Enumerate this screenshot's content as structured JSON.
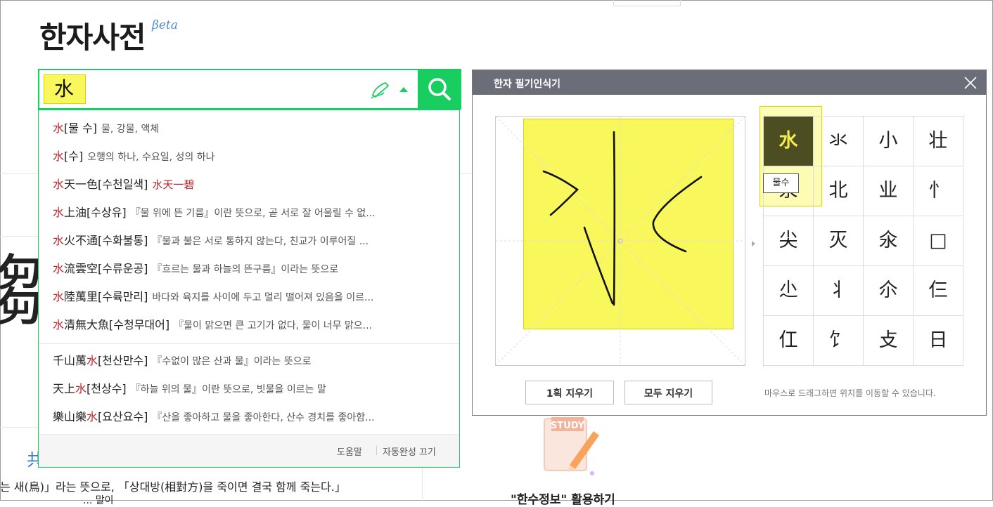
{
  "site": {
    "title": "한자사전",
    "beta": "βeta"
  },
  "search": {
    "value": "水"
  },
  "autocomplete": {
    "items": [
      {
        "pre": "",
        "hl": "水",
        "post": "",
        "reading": "[물 수]",
        "desc": "물, 강물, 액체"
      },
      {
        "pre": "",
        "hl": "水",
        "post": "",
        "reading": "[수]",
        "desc": "오행의 하나, 수요일, 성의 하나"
      },
      {
        "pre": "",
        "hl": "水",
        "post": "天一色",
        "reading": "[수천일색]",
        "desc": "",
        "extra": "水天一碧"
      },
      {
        "pre": "",
        "hl": "水",
        "post": "上油",
        "reading": "[수상유]",
        "desc": "『물 위에 뜬 기름』이란 뜻으로, 곧 서로 잘 어울릴 수 없..."
      },
      {
        "pre": "",
        "hl": "水",
        "post": "火不通",
        "reading": "[수화불통]",
        "desc": "『물과 불은 서로 통하지 않는다, 친교가 이루어질 ..."
      },
      {
        "pre": "",
        "hl": "水",
        "post": "流雲空",
        "reading": "[수류운공]",
        "desc": "『흐르는 물과 하늘의 뜬구름』이라는 뜻으로"
      },
      {
        "pre": "",
        "hl": "水",
        "post": "陸萬里",
        "reading": "[수륙만리]",
        "desc": "바다와 육지를 사이에 두고 멀리 떨어져 있음을 이르..."
      },
      {
        "pre": "",
        "hl": "水",
        "post": "清無大魚",
        "reading": "[수청무대어]",
        "desc": "『물이 맑으면 큰 고기가 없다, 물이 너무 맑으..."
      },
      {
        "pre": "千山萬",
        "hl": "水",
        "post": "",
        "reading": "[천산만수]",
        "desc": "『수없이 많은 산과 물』이라는 뜻으로"
      },
      {
        "pre": "天上",
        "hl": "水",
        "post": "",
        "reading": "[천상수]",
        "desc": "『하늘 위의 물』이란 뜻으로, 빗물을 이르는 말"
      },
      {
        "pre": "樂山樂",
        "hl": "水",
        "post": "",
        "reading": "[요산요수]",
        "desc": "『산을 좋아하고 물을 좋아한다, 산수 경치를 좋아함..."
      }
    ],
    "footer": {
      "help": "도움말",
      "autocomplete_off": "자동완성 끄기"
    }
  },
  "handwriting": {
    "title": "한자 필기인식기",
    "candidates": [
      "水",
      "氺",
      "小",
      "壮",
      "汖",
      "北",
      "业",
      "忄",
      "尖",
      "灭",
      "氽",
      "□",
      "尐",
      "丬",
      "尒",
      "仨",
      "仜",
      "饣",
      "攴",
      "日"
    ],
    "tooltip": "물수",
    "clear_one": "1획 지우기",
    "clear_all": "모두 지우기",
    "hint": "마우스로 드래그하면 위치를 이동할 수 있습니다."
  },
  "background": {
    "glyph": "鄒",
    "small_glyph": "共",
    "text1": "는 새(鳥)」라는 뜻으로, 「상대방(相對方)을 죽이면 결국 함께 죽는다.」",
    "text2": "... 말이",
    "study_label": "STUDY",
    "study_caption": "\"한수정보\" 활용하기"
  },
  "colors": {
    "accent": "#19ce60",
    "highlight": "#f8f85c",
    "hanja_red": "#b4292c",
    "header_gray": "#6b6e78"
  }
}
